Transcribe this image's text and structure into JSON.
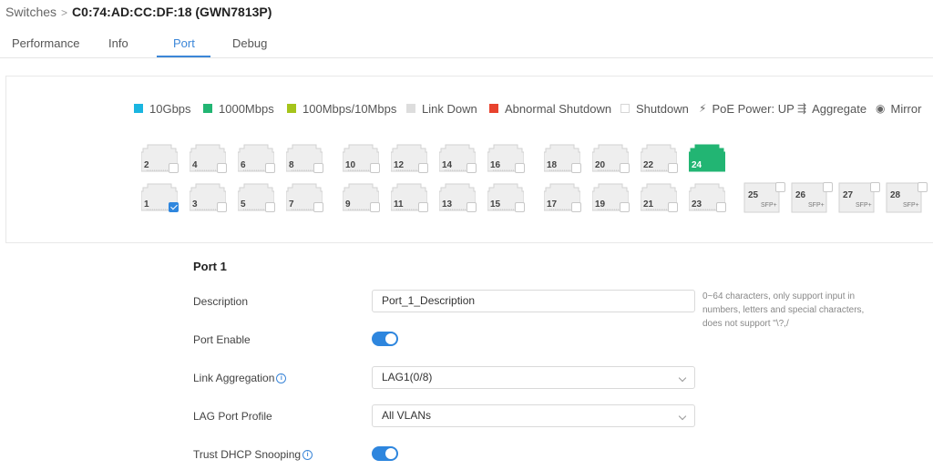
{
  "breadcrumb": {
    "parent": "Switches",
    "separator": ">",
    "current": "C0:74:AD:CC:DF:18 (GWN7813P)"
  },
  "tabs": [
    {
      "label": "Performance"
    },
    {
      "label": "Info"
    },
    {
      "label": "Port",
      "active": true
    },
    {
      "label": "Debug"
    }
  ],
  "legend": {
    "g10": {
      "label": "10Gbps",
      "color": "#1ab5e0"
    },
    "g1": {
      "label": "1000Mbps",
      "color": "#22b573"
    },
    "m100": {
      "label": "100Mbps/10Mbps",
      "color": "#a5c41b"
    },
    "down": {
      "label": "Link Down",
      "color": "#dddddd"
    },
    "abnormal": {
      "label": "Abnormal Shutdown",
      "color": "#e8432e"
    },
    "shutdown": {
      "label": "Shutdown"
    },
    "poe": {
      "label": "PoE Power: UP",
      "icon": "lightning-icon"
    },
    "aggregate": {
      "label": "Aggregate",
      "icon": "aggregate-icon"
    },
    "mirror": {
      "label": "Mirror",
      "icon": "eye-icon"
    }
  },
  "ports": {
    "top": [
      {
        "label": "2"
      },
      {
        "label": "4"
      },
      {
        "label": "6"
      },
      {
        "label": "8"
      },
      {
        "label": "10"
      },
      {
        "label": "12"
      },
      {
        "label": "14"
      },
      {
        "label": "16"
      },
      {
        "label": "18"
      },
      {
        "label": "20"
      },
      {
        "label": "22"
      },
      {
        "label": "24",
        "status": "1000Mbps"
      }
    ],
    "bottom": [
      {
        "label": "1",
        "checked": true
      },
      {
        "label": "3"
      },
      {
        "label": "5"
      },
      {
        "label": "7"
      },
      {
        "label": "9"
      },
      {
        "label": "11"
      },
      {
        "label": "13"
      },
      {
        "label": "15"
      },
      {
        "label": "17"
      },
      {
        "label": "19"
      },
      {
        "label": "21"
      },
      {
        "label": "23"
      }
    ],
    "sfp": [
      {
        "label": "25",
        "type": "SFP+"
      },
      {
        "label": "26",
        "type": "SFP+"
      },
      {
        "label": "27",
        "type": "SFP+"
      },
      {
        "label": "28",
        "type": "SFP+"
      }
    ]
  },
  "form": {
    "title": "Port 1",
    "description": {
      "label": "Description",
      "value": "Port_1_Description",
      "hint": "0~64 characters, only support input in numbers, letters and special characters, does not support \"\\?,/"
    },
    "port_enable": {
      "label": "Port Enable",
      "on": true
    },
    "link_aggregation": {
      "label": "Link Aggregation",
      "value": "LAG1(0/8)"
    },
    "lag_port_profile": {
      "label": "LAG Port Profile",
      "value": "All VLANs"
    },
    "trust_dhcp": {
      "label": "Trust DHCP Snooping",
      "on": true
    }
  }
}
